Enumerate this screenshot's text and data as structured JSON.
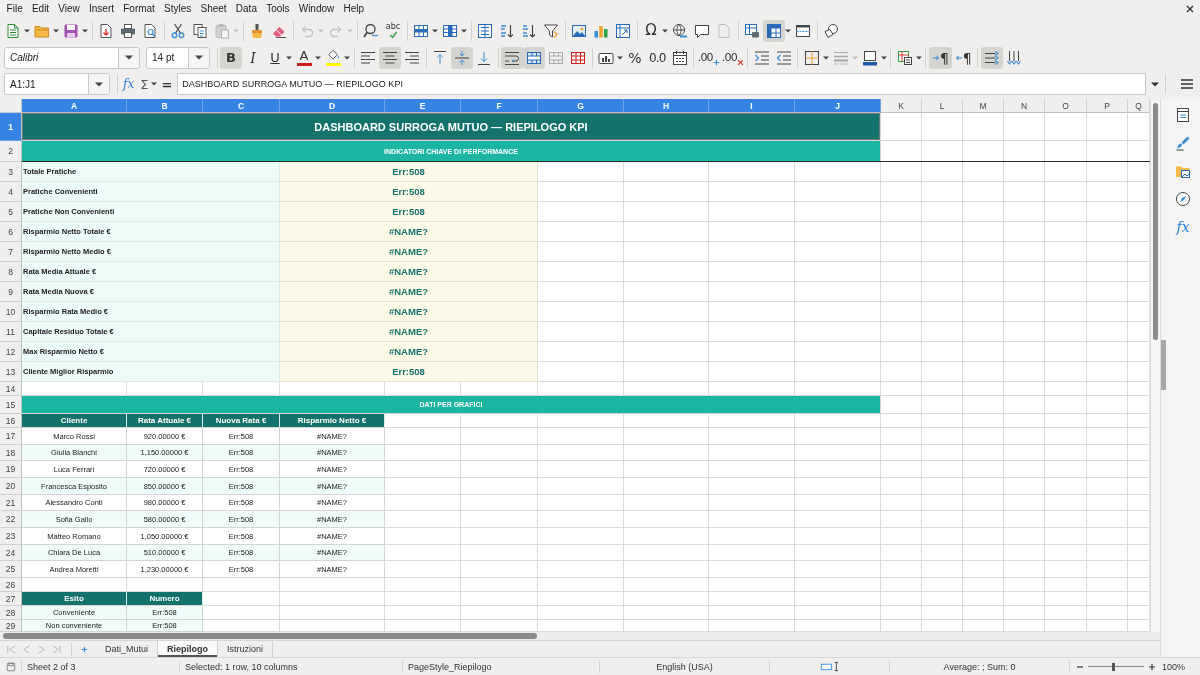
{
  "menu_bar": [
    "File",
    "Edit",
    "View",
    "Insert",
    "Format",
    "Styles",
    "Sheet",
    "Data",
    "Tools",
    "Window",
    "Help"
  ],
  "standard_toolbar": [
    [
      {
        "kind": "new",
        "disabled": false,
        "on": false,
        "has_dropdown": true
      },
      {
        "kind": "open",
        "disabled": false,
        "on": false,
        "has_dropdown": true
      },
      {
        "kind": "save",
        "disabled": false,
        "on": false,
        "has_dropdown": true
      }
    ],
    [
      {
        "kind": "export_pdf",
        "disabled": false,
        "on": false,
        "has_dropdown": false
      },
      {
        "kind": "print",
        "disabled": false,
        "on": false,
        "has_dropdown": false
      },
      {
        "kind": "print_preview",
        "disabled": false,
        "on": false,
        "has_dropdown": false
      }
    ],
    [
      {
        "kind": "cut",
        "disabled": false,
        "on": false,
        "has_dropdown": false
      },
      {
        "kind": "copy",
        "disabled": false,
        "on": false,
        "has_dropdown": false
      },
      {
        "kind": "paste",
        "disabled": true,
        "on": false,
        "has_dropdown": true
      }
    ],
    [
      {
        "kind": "clone_formatting",
        "disabled": false,
        "on": false,
        "has_dropdown": false
      },
      {
        "kind": "clear_formatting",
        "disabled": false,
        "on": false,
        "has_dropdown": false
      }
    ],
    [
      {
        "kind": "undo",
        "disabled": true,
        "on": false,
        "has_dropdown": true
      },
      {
        "kind": "redo",
        "disabled": true,
        "on": false,
        "has_dropdown": true
      }
    ],
    [
      {
        "kind": "find_replace",
        "disabled": false,
        "on": false,
        "has_dropdown": false
      },
      {
        "kind": "spelling",
        "label": "abc",
        "disabled": false,
        "on": false,
        "has_dropdown": false
      }
    ],
    [
      {
        "kind": "rows",
        "disabled": false,
        "on": false,
        "has_dropdown": true
      },
      {
        "kind": "columns",
        "disabled": false,
        "on": false,
        "has_dropdown": true
      }
    ],
    [
      {
        "kind": "sort",
        "disabled": false,
        "on": false,
        "has_dropdown": false
      },
      {
        "kind": "sort_ascending",
        "disabled": false,
        "on": false,
        "has_dropdown": false
      },
      {
        "kind": "sort_descending",
        "disabled": false,
        "on": false,
        "has_dropdown": false
      },
      {
        "kind": "autofilter",
        "disabled": false,
        "on": false,
        "has_dropdown": false
      }
    ],
    [
      {
        "kind": "image",
        "disabled": false,
        "on": false,
        "has_dropdown": false
      },
      {
        "kind": "chart",
        "disabled": false,
        "on": false,
        "has_dropdown": false
      },
      {
        "kind": "pivot_table",
        "disabled": false,
        "on": false,
        "has_dropdown": false
      }
    ],
    [
      {
        "kind": "special_character",
        "label": "Ω",
        "disabled": false,
        "on": false,
        "has_dropdown": true
      },
      {
        "kind": "hyperlink",
        "disabled": false,
        "on": false,
        "has_dropdown": false
      },
      {
        "kind": "comment",
        "disabled": false,
        "on": false,
        "has_dropdown": false
      },
      {
        "kind": "header_footer",
        "disabled": true,
        "on": false,
        "has_dropdown": false
      }
    ],
    [
      {
        "kind": "print_area",
        "disabled": false,
        "on": false,
        "has_dropdown": false
      },
      {
        "kind": "freeze",
        "disabled": false,
        "on": true,
        "has_dropdown": true
      },
      {
        "kind": "split_window",
        "disabled": false,
        "on": false,
        "has_dropdown": false
      }
    ],
    [
      {
        "kind": "draw_functions",
        "disabled": false,
        "on": false,
        "has_dropdown": false
      }
    ]
  ],
  "formatting_toolbar": {
    "font_name": "Calibri",
    "font_size": "14 pt",
    "groups": [
      [
        {
          "kind": "bold",
          "label": "B",
          "disabled": false,
          "on": true,
          "has_dropdown": false
        },
        {
          "kind": "italic",
          "label": "I",
          "disabled": false,
          "on": false,
          "has_dropdown": false
        },
        {
          "kind": "underline",
          "label": "U",
          "disabled": false,
          "on": false,
          "has_dropdown": true
        },
        {
          "kind": "font_color",
          "label": "A",
          "color": "#c9211e",
          "disabled": false,
          "on": false,
          "has_dropdown": true
        },
        {
          "kind": "highlight",
          "color": "#ffff00",
          "disabled": false,
          "on": false,
          "has_dropdown": true
        }
      ],
      [
        {
          "kind": "align_left",
          "disabled": false,
          "on": false,
          "has_dropdown": false
        },
        {
          "kind": "align_center",
          "disabled": false,
          "on": true,
          "has_dropdown": false
        },
        {
          "kind": "align_right",
          "disabled": false,
          "on": false,
          "has_dropdown": false
        }
      ],
      [
        {
          "kind": "align_top",
          "disabled": false,
          "on": false,
          "has_dropdown": false
        },
        {
          "kind": "align_middle",
          "disabled": false,
          "on": true,
          "has_dropdown": false
        },
        {
          "kind": "align_bottom",
          "disabled": false,
          "on": false,
          "has_dropdown": false
        }
      ],
      [
        {
          "kind": "wrap_text",
          "disabled": false,
          "on": true,
          "has_dropdown": false
        },
        {
          "kind": "merge_center",
          "disabled": false,
          "on": true,
          "has_dropdown": false
        },
        {
          "kind": "merge",
          "disabled": false,
          "on": false,
          "has_dropdown": false
        },
        {
          "kind": "unmerge",
          "disabled": false,
          "on": false,
          "has_dropdown": false
        }
      ],
      [
        {
          "kind": "number_format",
          "disabled": false,
          "on": false,
          "has_dropdown": true
        },
        {
          "kind": "percent",
          "label": "%",
          "disabled": false,
          "on": false,
          "has_dropdown": false
        },
        {
          "kind": "standard_format",
          "label": "0.0",
          "disabled": false,
          "on": false,
          "has_dropdown": false
        },
        {
          "kind": "date_format",
          "disabled": false,
          "on": false,
          "has_dropdown": false
        }
      ],
      [
        {
          "kind": "add_decimal",
          "label": ".00",
          "disabled": false,
          "on": false,
          "has_dropdown": false
        },
        {
          "kind": "delete_decimal",
          "label": ".00",
          "disabled": false,
          "on": false,
          "has_dropdown": false
        }
      ],
      [
        {
          "kind": "indent_increase",
          "disabled": false,
          "on": false,
          "has_dropdown": false
        },
        {
          "kind": "indent_decrease",
          "disabled": false,
          "on": false,
          "has_dropdown": false
        }
      ],
      [
        {
          "kind": "borders",
          "disabled": false,
          "on": false,
          "has_dropdown": true
        },
        {
          "kind": "border_style",
          "disabled": true,
          "on": false,
          "has_dropdown": true
        },
        {
          "kind": "border_color",
          "disabled": false,
          "on": false,
          "has_dropdown": true
        }
      ],
      [
        {
          "kind": "conditional",
          "disabled": false,
          "on": false,
          "has_dropdown": true
        }
      ],
      [
        {
          "kind": "ltr",
          "label": "¶",
          "disabled": false,
          "on": true,
          "has_dropdown": false
        },
        {
          "kind": "rtl",
          "label": "¶",
          "disabled": false,
          "on": false,
          "has_dropdown": false
        }
      ],
      [
        {
          "kind": "text_horizontal",
          "disabled": false,
          "on": true,
          "has_dropdown": false
        },
        {
          "kind": "text_vertical",
          "disabled": false,
          "on": false,
          "has_dropdown": false
        }
      ]
    ]
  },
  "formula_bar": {
    "name_box": "A1:J1",
    "function_wizard": "fx",
    "sum": "Σ",
    "equals": "=",
    "content": "DASHBOARD SURROGA MUTUO — RIEPILOGO KPI"
  },
  "columns": [
    {
      "label": "A",
      "selected": true
    },
    {
      "label": "B",
      "selected": true
    },
    {
      "label": "C",
      "selected": true
    },
    {
      "label": "D",
      "selected": true
    },
    {
      "label": "E",
      "selected": true
    },
    {
      "label": "F",
      "selected": true
    },
    {
      "label": "G",
      "selected": true
    },
    {
      "label": "H",
      "selected": true
    },
    {
      "label": "I",
      "selected": true
    },
    {
      "label": "J",
      "selected": true
    },
    {
      "label": "K",
      "selected": false
    },
    {
      "label": "L",
      "selected": false
    },
    {
      "label": "M",
      "selected": false
    },
    {
      "label": "N",
      "selected": false
    },
    {
      "label": "O",
      "selected": false
    },
    {
      "label": "P",
      "selected": false
    },
    {
      "label": "Q",
      "selected": false
    }
  ],
  "rows": [
    {
      "label": "1",
      "selected": true
    },
    {
      "label": "2",
      "selected": false
    },
    {
      "label": "3",
      "selected": false
    },
    {
      "label": "4",
      "selected": false
    },
    {
      "label": "5",
      "selected": false
    },
    {
      "label": "6",
      "selected": false
    },
    {
      "label": "7",
      "selected": false
    },
    {
      "label": "8",
      "selected": false
    },
    {
      "label": "9",
      "selected": false
    },
    {
      "label": "10",
      "selected": false
    },
    {
      "label": "11",
      "selected": false
    },
    {
      "label": "12",
      "selected": false
    },
    {
      "label": "13",
      "selected": false
    },
    {
      "label": "14",
      "selected": false
    },
    {
      "label": "15",
      "selected": false
    },
    {
      "label": "16",
      "selected": false
    },
    {
      "label": "17",
      "selected": false
    },
    {
      "label": "18",
      "selected": false
    },
    {
      "label": "19",
      "selected": false
    },
    {
      "label": "20",
      "selected": false
    },
    {
      "label": "21",
      "selected": false
    },
    {
      "label": "22",
      "selected": false
    },
    {
      "label": "23",
      "selected": false
    },
    {
      "label": "24",
      "selected": false
    },
    {
      "label": "25",
      "selected": false
    },
    {
      "label": "26",
      "selected": false
    },
    {
      "label": "27",
      "selected": false
    },
    {
      "label": "28",
      "selected": false
    },
    {
      "label": "29",
      "selected": false
    }
  ],
  "dashboard": {
    "title": "DASHBOARD SURROGA MUTUO — RIEPILOGO KPI",
    "subtitle": "INDICATORI CHIAVE DI PERFORMANCE",
    "kpis": [
      {
        "label": "Totale Pratiche",
        "value": "Err:508"
      },
      {
        "label": "Pratiche Convenienti",
        "value": "Err:508"
      },
      {
        "label": "Pratiche Non Convenienti",
        "value": "Err:508"
      },
      {
        "label": "Risparmio Netto Totale €",
        "value": "#NAME?"
      },
      {
        "label": "Risparmio Netto Medio €",
        "value": "#NAME?"
      },
      {
        "label": "Rata Media Attuale €",
        "value": "#NAME?"
      },
      {
        "label": "Rata Media Nuova €",
        "value": "#NAME?"
      },
      {
        "label": "Risparmio Rata Medio €",
        "value": "#NAME?"
      },
      {
        "label": "Capitale Residuo Totale €",
        "value": "#NAME?"
      },
      {
        "label": "Max Risparmio Netto €",
        "value": "#NAME?"
      },
      {
        "label": "Cliente Miglior Risparmio",
        "value": "Err:508"
      }
    ],
    "section_title": "DATI PER GRAFICI",
    "client_table": {
      "columns": [
        "Cliente",
        "Rata Attuale €",
        "Nuova Rata €",
        "Risparmio Netto €"
      ],
      "rows": [
        [
          "Marco Rossi",
          "920.00000 €",
          "Err:508",
          "#NAME?"
        ],
        [
          "Giulia Bianchi",
          "1,150.00000 €",
          "Err:508",
          "#NAME?"
        ],
        [
          "Luca Ferrari",
          "720.00000 €",
          "Err:508",
          "#NAME?"
        ],
        [
          "Francesca Esposito",
          "850.00000 €",
          "Err:508",
          "#NAME?"
        ],
        [
          "Alessandro Conti",
          "980.00000 €",
          "Err:508",
          "#NAME?"
        ],
        [
          "Sofia Gallo",
          "580.00000 €",
          "Err:508",
          "#NAME?"
        ],
        [
          "Matteo Romano",
          "1,050.00000 €",
          "Err:508",
          "#NAME?"
        ],
        [
          "Chiara De Luca",
          "510.00000 €",
          "Err:508",
          "#NAME?"
        ],
        [
          "Andrea Moretti",
          "1,230.00000 €",
          "Err:508",
          "#NAME?"
        ]
      ]
    },
    "outcome_table": {
      "columns": [
        "Esito",
        "Numero"
      ],
      "rows": [
        [
          "Conveniente",
          "Err:508"
        ],
        [
          "Non conveniente",
          "Err:508"
        ]
      ]
    }
  },
  "sidebar": {
    "functions_label": "fx"
  },
  "sheet_tabs": [
    {
      "label": "Dati_Mutui",
      "selected": false
    },
    {
      "label": "Riepilogo",
      "selected": true
    },
    {
      "label": "Istruzioni",
      "selected": false
    }
  ],
  "status_bar": {
    "sheet_position": "Sheet 2 of 3",
    "selection": "Selected: 1 row, 10 columns",
    "page_style": "PageStyle_Riepilogo",
    "language": "English (USA)",
    "summary": "Average: ; Sum: 0",
    "zoom_slider": {
      "level": 0.45
    },
    "zoom": "100%"
  }
}
